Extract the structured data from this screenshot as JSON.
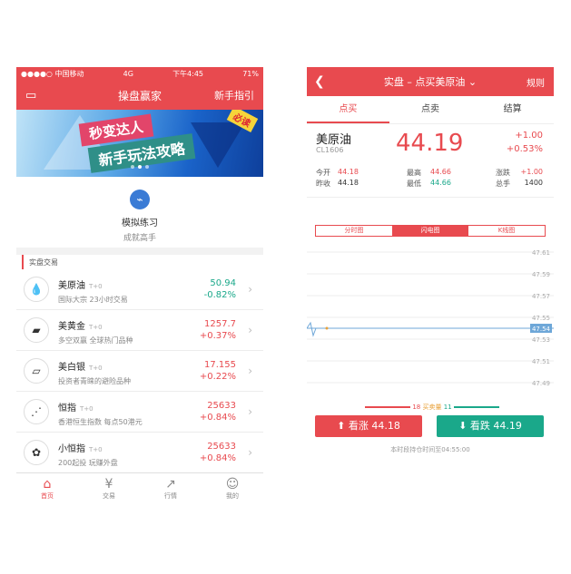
{
  "left_screen": {
    "status": {
      "carrier": "●●●●○ 中国移动",
      "network": "4G",
      "time": "下午4:45",
      "battery": "71%"
    },
    "nav": {
      "title": "操盘赢家",
      "right": "新手指引"
    },
    "banner": {
      "line1": "秒变达人",
      "line2": "新手玩法攻略",
      "tag": "必读"
    },
    "simulate": {
      "title": "模拟练习",
      "subtitle": "成就高手"
    },
    "section_title": "实盘交易",
    "items": [
      {
        "name": "美原油",
        "type": "T+0",
        "desc": "国际大宗 23小时交易",
        "price": "50.94",
        "change": "-0.82%",
        "price_color": "green",
        "change_color": "green",
        "icon": "oil-drop-icon",
        "glyph": "💧"
      },
      {
        "name": "美黄金",
        "type": "T+0",
        "desc": "多空双赢 全球热门品种",
        "price": "1257.7",
        "change": "+0.37%",
        "price_color": "red",
        "change_color": "red",
        "icon": "gold-bar-icon",
        "glyph": "▰"
      },
      {
        "name": "美白银",
        "type": "T+0",
        "desc": "投资者青睐的避险品种",
        "price": "17.155",
        "change": "+0.22%",
        "price_color": "red",
        "change_color": "red",
        "icon": "silver-bar-icon",
        "glyph": "▱"
      },
      {
        "name": "恒指",
        "type": "T+0",
        "desc": "香港恒生指数 每点50港元",
        "price": "25633",
        "change": "+0.84%",
        "price_color": "red",
        "change_color": "red",
        "icon": "index-chart-icon",
        "glyph": "⋰"
      },
      {
        "name": "小恒指",
        "type": "T+0",
        "desc": "200起投 玩赚外盘",
        "price": "25633",
        "change": "+0.84%",
        "price_color": "red",
        "change_color": "red",
        "icon": "bauhinia-icon",
        "glyph": "✿"
      }
    ],
    "tabbar": [
      {
        "label": "首页",
        "icon": "home-icon",
        "glyph": "⌂",
        "active": true
      },
      {
        "label": "交易",
        "icon": "trade-icon",
        "glyph": "¥",
        "active": false
      },
      {
        "label": "行情",
        "icon": "market-icon",
        "glyph": "↗",
        "active": false
      },
      {
        "label": "我的",
        "icon": "profile-icon",
        "glyph": "☺",
        "active": false
      }
    ]
  },
  "right_screen": {
    "nav": {
      "title": "实盘 – 点买美原油",
      "right": "规则"
    },
    "tabs": [
      "点买",
      "点卖",
      "结算"
    ],
    "quote": {
      "name": "美原油",
      "code": "CL1606",
      "price": "44.19",
      "change": "+1.00",
      "change_pct": "+0.53%"
    },
    "stats": {
      "open_label": "今开",
      "open": "44.18",
      "prev_label": "昨收",
      "prev": "44.18",
      "high_label": "最高",
      "high": "44.66",
      "low_label": "最低",
      "low": "44.66",
      "rise_label": "涨跌",
      "rise": "+1.00",
      "vol_label": "总手",
      "vol": "1400"
    },
    "chart_tabs": [
      "分时图",
      "闪电图",
      "K线图"
    ],
    "chart_tab_active": 1,
    "price_levels": [
      "47.61",
      "47.59",
      "47.57",
      "47.55",
      "47.54",
      "47.53",
      "47.51",
      "47.49"
    ],
    "current_level": "47.54",
    "ratio": {
      "buy": "18",
      "label": "买卖量",
      "sell": "11"
    },
    "buy_button": "看涨 44.18",
    "sell_button": "看跌 44.19",
    "note": "本时段持仓时间至04:55:00",
    "colors": {
      "up": "#e84a4f",
      "down": "#1aa88a",
      "line": "#6ea7d8"
    }
  }
}
